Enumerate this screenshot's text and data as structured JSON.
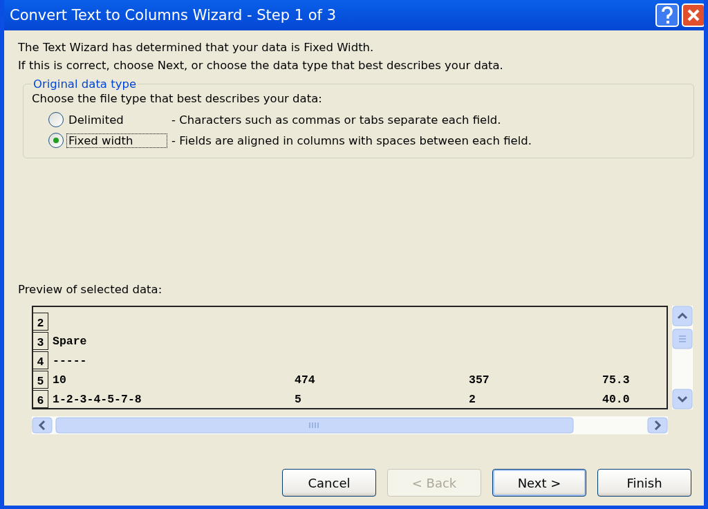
{
  "window": {
    "title": "Convert Text to Columns Wizard - Step 1 of 3"
  },
  "intro": [
    "The Text Wizard has determined that your data is Fixed Width.",
    "If this is correct, choose Next, or choose the data type that best describes your data."
  ],
  "group": {
    "legend": "Original data type",
    "prompt": "Choose the file type that best describes your data:",
    "options": [
      {
        "label": "Delimited",
        "description": "- Characters such as commas or tabs separate each field.",
        "selected": false
      },
      {
        "label": "Fixed width",
        "description": "- Fields are aligned in columns with spaces between each field.",
        "selected": true
      }
    ]
  },
  "preview": {
    "label": "Preview of selected data:",
    "rows": [
      {
        "number": "2",
        "cells": []
      },
      {
        "number": "3",
        "cells": [
          "Spare"
        ]
      },
      {
        "number": "4",
        "cells": [
          "-----"
        ]
      },
      {
        "number": "5",
        "cells": [
          "10",
          "474",
          "357",
          "75.3"
        ]
      },
      {
        "number": "6",
        "cells": [
          "1-2-3-4-5-7-8",
          "5",
          "2",
          "40.0"
        ]
      }
    ]
  },
  "buttons": [
    {
      "label": "Cancel",
      "disabled": false,
      "default": false
    },
    {
      "label": "< Back",
      "disabled": true,
      "default": false
    },
    {
      "label": "Next >",
      "disabled": false,
      "default": true
    },
    {
      "label": "Finish",
      "disabled": false,
      "default": false
    }
  ]
}
